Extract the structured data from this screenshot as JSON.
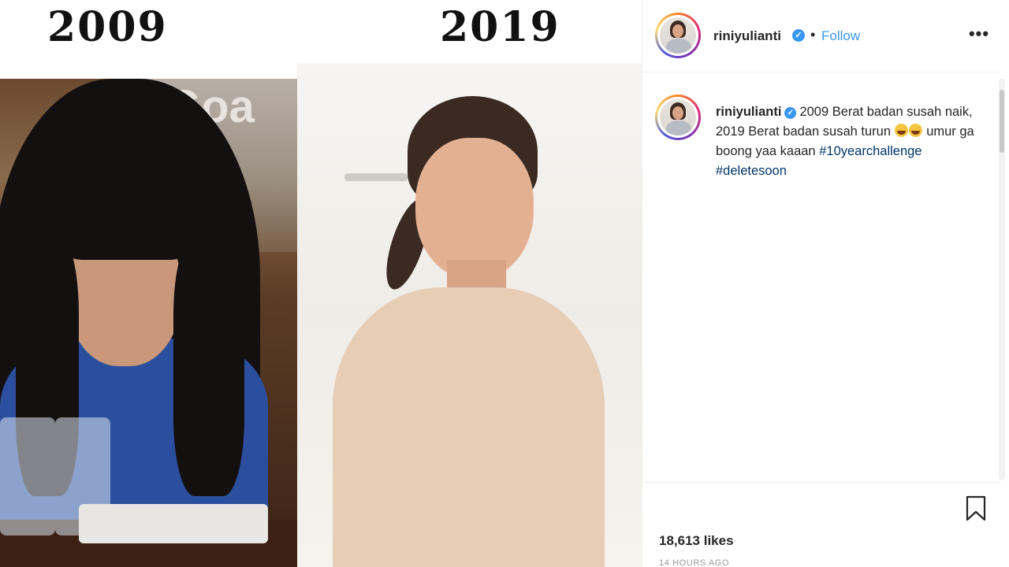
{
  "image": {
    "left_year": "2009",
    "right_year": "2019",
    "sign_text": "Goa"
  },
  "post": {
    "username": "riniyulianti",
    "verified_icon": "verified-badge-icon",
    "separator": "•",
    "follow_label": "Follow",
    "more_icon": "•••",
    "caption": {
      "username": "riniyulianti",
      "text": "2009 Berat badan susah naik, 2019 Berat badan susah turun",
      "emoji": "face-with-tears-of-joy-icon",
      "text_after": "umur ga boong yaa kaaan",
      "hashtags": [
        "#10yearchallenge",
        "#deletesoon"
      ]
    },
    "likes": "18,613 likes",
    "time_ago": "14 HOURS AGO"
  },
  "colors": {
    "link_blue": "#3897f0",
    "hashtag_blue": "#003569",
    "text": "#262626",
    "muted": "#999999"
  }
}
